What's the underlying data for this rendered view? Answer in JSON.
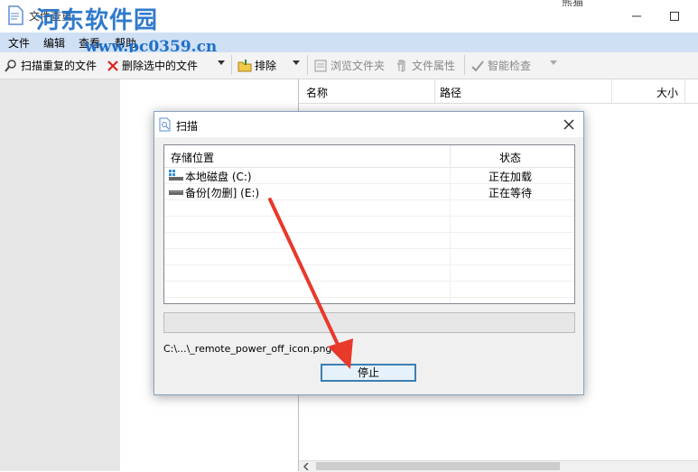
{
  "window": {
    "title": "文件查重",
    "watermark": "河东软件园",
    "watermark_url": "www.pc0359.cn",
    "title_right_label": "熊猫"
  },
  "menu": [
    "文件",
    "编辑",
    "查看",
    "帮助"
  ],
  "toolbar": {
    "scan_label": "扫描重复的文件",
    "delete_label": "删除选中的文件",
    "exclude_label": "排除",
    "browse_label": "浏览文件夹",
    "properties_label": "文件属性",
    "smart_check_label": "智能检查"
  },
  "results_columns": [
    "名称",
    "路径",
    "大小"
  ],
  "dialog": {
    "title": "扫描",
    "columns": [
      "存储位置",
      "状态"
    ],
    "rows": [
      {
        "icon": "local-disk-icon",
        "location": "本地磁盘 (C:)",
        "status": "正在加载"
      },
      {
        "icon": "drive-icon",
        "location": "备份[勿删] (E:)",
        "status": "正在等待"
      }
    ],
    "current_file": "C:\\...\\_remote_power_off_icon.png",
    "stop_label": "停止"
  },
  "colors": {
    "menubar": "#cfe0f5",
    "accent": "#3c7fb1",
    "arrow": "#e8392a",
    "watermark": "#1f6fc8"
  }
}
